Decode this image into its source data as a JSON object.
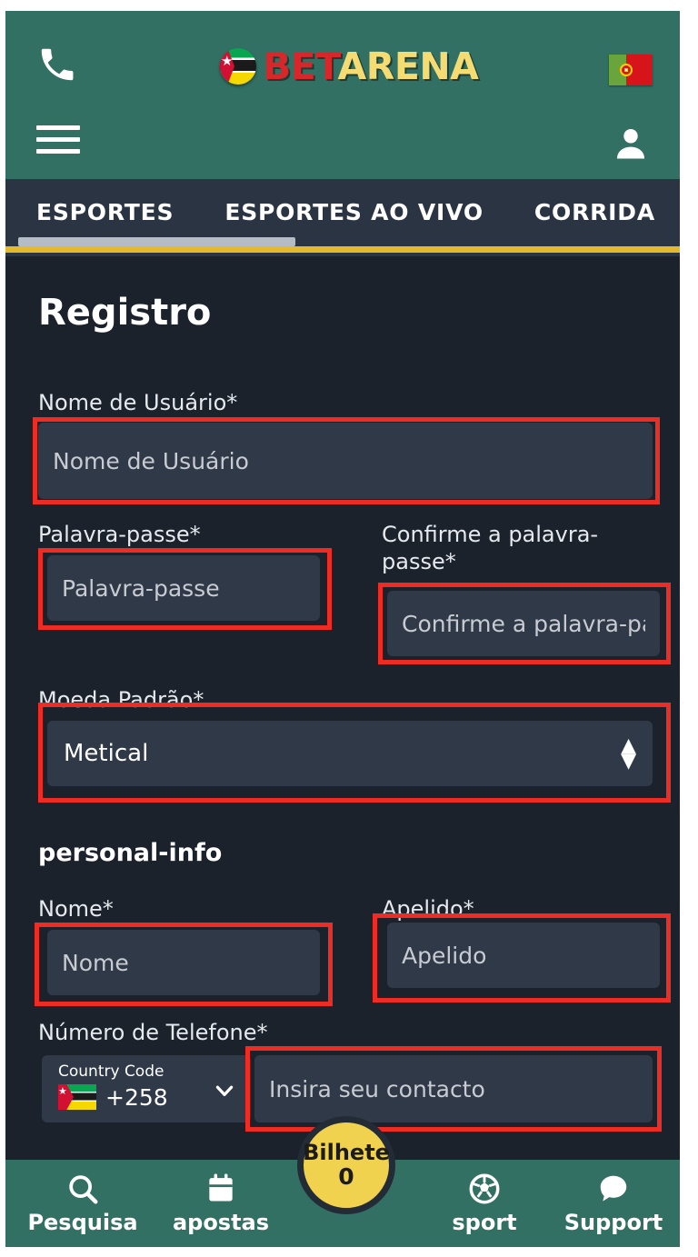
{
  "header": {
    "phone_icon": "phone-icon",
    "logo": {
      "part1": "BET",
      "part2": "ARENA",
      "flag": "mozambique-flag-icon"
    },
    "language_flag": "portugal-flag-icon",
    "menu_icon": "hamburger-menu-icon",
    "account_icon": "user-account-icon"
  },
  "nav": {
    "tabs": [
      {
        "label": "ESPORTES",
        "active": true
      },
      {
        "label": "ESPORTES AO VIVO",
        "active": false
      },
      {
        "label": "CORRIDA",
        "active": false
      }
    ]
  },
  "form": {
    "title": "Registro",
    "username": {
      "label": "Nome de Usuário*",
      "placeholder": "Nome de Usuário",
      "value": ""
    },
    "password": {
      "label": "Palavra-passe*",
      "placeholder": "Palavra-passe",
      "value": ""
    },
    "confirm_password": {
      "label": "Confirme a palavra-passe*",
      "placeholder": "Confirme a palavra-passe",
      "value": ""
    },
    "currency": {
      "label": "Moeda Padrão*",
      "selected": "Metical"
    },
    "section_personal": "personal-info",
    "first_name": {
      "label": "Nome*",
      "placeholder": "Nome",
      "value": ""
    },
    "last_name": {
      "label": "Apelido*",
      "placeholder": "Apelido",
      "value": ""
    },
    "phone": {
      "label": "Número de Telefone*",
      "country_code_label": "Country Code",
      "country_code_value": "+258",
      "country_flag": "mozambique-flag-icon",
      "placeholder": "Insira seu contacto",
      "value": ""
    }
  },
  "bottom_nav": {
    "items": [
      {
        "label": "Pesquisa",
        "icon": "search-icon"
      },
      {
        "label": "apostas",
        "icon": "calendar-icon"
      },
      {
        "label": "sport",
        "icon": "soccer-ball-icon"
      },
      {
        "label": "Support",
        "icon": "chat-bubble-icon"
      }
    ],
    "fab": {
      "title": "Bilhete",
      "count": "0"
    }
  },
  "colors": {
    "header_teal": "#327063",
    "page_bg": "#1b222c",
    "nav_bg": "#2b3442",
    "input_bg": "#2f3947",
    "gold": "#e5b92c",
    "annotation_red": "#ef2c24",
    "fab_yellow": "#f0d24e",
    "logo_red": "#d7272b",
    "logo_yellow": "#f4dc73"
  }
}
